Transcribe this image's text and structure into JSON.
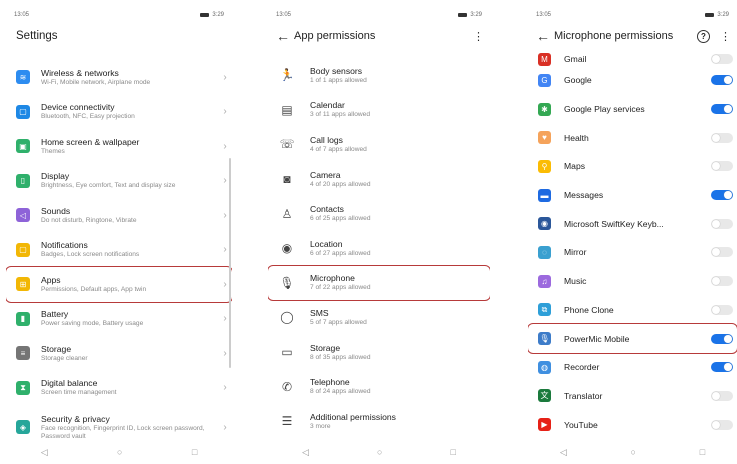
{
  "status": {
    "time": "13:05",
    "right": "3:29"
  },
  "settings": {
    "title": "Settings",
    "items": [
      {
        "label": "Wireless & networks",
        "sub": "Wi-Fi, Mobile network, Airplane mode",
        "icon": "wifi-icon",
        "color": "#2d8cf0",
        "glyph": "≋"
      },
      {
        "label": "Device connectivity",
        "sub": "Bluetooth, NFC, Easy projection",
        "icon": "device-icon",
        "color": "#1e88e5",
        "glyph": "▢"
      },
      {
        "label": "Home screen & wallpaper",
        "sub": "Themes",
        "icon": "wallpaper-icon",
        "color": "#2fb06b",
        "glyph": "▣"
      },
      {
        "label": "Display",
        "sub": "Brightness, Eye comfort, Text and display size",
        "icon": "display-icon",
        "color": "#2fb06b",
        "glyph": "▯"
      },
      {
        "label": "Sounds",
        "sub": "Do not disturb, Ringtone, Vibrate",
        "icon": "sound-icon",
        "color": "#8e63d8",
        "glyph": "◁"
      },
      {
        "label": "Notifications",
        "sub": "Badges, Lock screen notifications",
        "icon": "notification-icon",
        "color": "#f2b705",
        "glyph": "▢"
      },
      {
        "label": "Apps",
        "sub": "Permissions, Default apps, App twin",
        "icon": "apps-icon",
        "color": "#f2b705",
        "glyph": "⊞"
      },
      {
        "label": "Battery",
        "sub": "Power saving mode, Battery usage",
        "icon": "battery-icon",
        "color": "#2fb06b",
        "glyph": "▮"
      },
      {
        "label": "Storage",
        "sub": "Storage cleaner",
        "icon": "storage-icon",
        "color": "#757575",
        "glyph": "≡"
      },
      {
        "label": "Digital balance",
        "sub": "Screen time management",
        "icon": "balance-icon",
        "color": "#2fb06b",
        "glyph": "⧗"
      },
      {
        "label": "Security & privacy",
        "sub": "Face recognition, Fingerprint ID, Lock screen password, Password vault",
        "icon": "shield-icon",
        "color": "#26a69a",
        "glyph": "◈"
      }
    ]
  },
  "permissions": {
    "title": "App permissions",
    "items": [
      {
        "label": "Body sensors",
        "sub": "1 of 1 apps allowed",
        "icon": "running-icon",
        "glyph": "🏃"
      },
      {
        "label": "Calendar",
        "sub": "3 of 11 apps allowed",
        "icon": "calendar-icon",
        "glyph": "▤"
      },
      {
        "label": "Call logs",
        "sub": "4 of 7 apps allowed",
        "icon": "call-log-icon",
        "glyph": "☏"
      },
      {
        "label": "Camera",
        "sub": "4 of 20 apps allowed",
        "icon": "camera-icon",
        "glyph": "◙"
      },
      {
        "label": "Contacts",
        "sub": "6 of 25 apps allowed",
        "icon": "contacts-icon",
        "glyph": "♙"
      },
      {
        "label": "Location",
        "sub": "6 of 27 apps allowed",
        "icon": "location-icon",
        "glyph": "◉"
      },
      {
        "label": "Microphone",
        "sub": "7 of 22 apps allowed",
        "icon": "microphone-icon",
        "glyph": "🎙"
      },
      {
        "label": "SMS",
        "sub": "5 of 7 apps allowed",
        "icon": "sms-icon",
        "glyph": "◯"
      },
      {
        "label": "Storage",
        "sub": "8 of 35 apps allowed",
        "icon": "folder-icon",
        "glyph": "▭"
      },
      {
        "label": "Telephone",
        "sub": "8 of 24 apps allowed",
        "icon": "phone-icon",
        "glyph": "✆"
      },
      {
        "label": "Additional permissions",
        "sub": "3 more",
        "icon": "list-icon",
        "glyph": "☰"
      }
    ]
  },
  "microphone": {
    "title": "Microphone permissions",
    "items": [
      {
        "label": "Gmail",
        "on": false,
        "icon": "gmail-icon",
        "color": "#d93025",
        "glyph": "M"
      },
      {
        "label": "Google",
        "on": true,
        "icon": "google-icon",
        "color": "#4285f4",
        "glyph": "G"
      },
      {
        "label": "Google Play services",
        "on": true,
        "icon": "play-services-icon",
        "color": "#34a853",
        "glyph": "✱"
      },
      {
        "label": "Health",
        "on": false,
        "icon": "health-icon",
        "color": "#f5a35b",
        "glyph": "♥"
      },
      {
        "label": "Maps",
        "on": false,
        "icon": "maps-icon",
        "color": "#fbbc04",
        "glyph": "⚲"
      },
      {
        "label": "Messages",
        "on": true,
        "icon": "messages-icon",
        "color": "#1e6ae1",
        "glyph": "▬"
      },
      {
        "label": "Microsoft SwiftKey Keyb...",
        "on": false,
        "icon": "swiftkey-icon",
        "color": "#2b579a",
        "glyph": "◉"
      },
      {
        "label": "Mirror",
        "on": false,
        "icon": "mirror-icon",
        "color": "#3aa0d0",
        "glyph": "◌"
      },
      {
        "label": "Music",
        "on": false,
        "icon": "music-icon",
        "color": "#9c6ade",
        "glyph": "♫"
      },
      {
        "label": "Phone Clone",
        "on": false,
        "icon": "phone-clone-icon",
        "color": "#2e9fd8",
        "glyph": "⧉"
      },
      {
        "label": "PowerMic Mobile",
        "on": true,
        "icon": "powermic-icon",
        "color": "#3d7cc9",
        "glyph": "🎙"
      },
      {
        "label": "Recorder",
        "on": true,
        "icon": "recorder-icon",
        "color": "#3f8fe0",
        "glyph": "◍"
      },
      {
        "label": "Translator",
        "on": false,
        "icon": "translator-icon",
        "color": "#1b7a3d",
        "glyph": "文"
      },
      {
        "label": "YouTube",
        "on": false,
        "icon": "youtube-icon",
        "color": "#e62117",
        "glyph": "▶"
      }
    ]
  }
}
